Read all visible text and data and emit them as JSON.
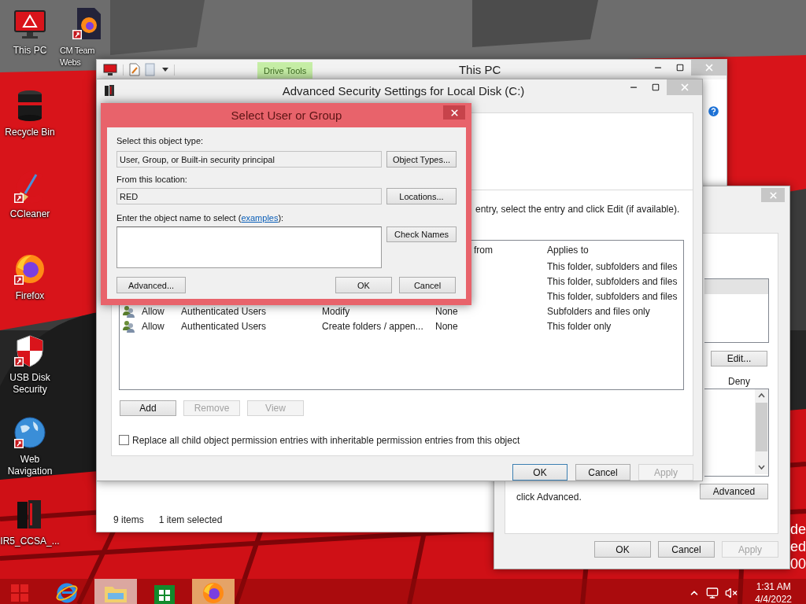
{
  "desktop": {
    "columns": [
      [
        {
          "kind": "this_pc",
          "label": "This PC",
          "shortcut": false
        },
        {
          "kind": "recycle_bin",
          "label": "Recycle Bin",
          "shortcut": false
        },
        {
          "kind": "ccleaner",
          "label": "CCleaner",
          "shortcut": true
        },
        {
          "kind": "firefox",
          "label": "Firefox",
          "shortcut": true
        },
        {
          "kind": "usb_security",
          "label": "USB Disk Security",
          "shortcut": true
        },
        {
          "kind": "web_navigation",
          "label": "Web Navigation",
          "shortcut": true
        },
        {
          "kind": "ir5",
          "label": "IR5_CCSA_...",
          "shortcut": false
        }
      ],
      [
        {
          "kind": "web_document",
          "label": "CM Team Webs",
          "shortcut": true
        }
      ]
    ],
    "corner_text": [
      "de",
      "ed",
      "00"
    ]
  },
  "explorer": {
    "title": "This PC",
    "ribbon_tab": "Drive Tools",
    "status": [
      "9 items",
      "1 item selected"
    ]
  },
  "properties": {
    "list_rows": [
      {
        "selected": true
      }
    ],
    "deny_header": "Deny",
    "edit_button": "Edit...",
    "note": "click Advanced.",
    "advanced_button": "Advanced",
    "footer_buttons": [
      {
        "label": "OK",
        "disabled": false,
        "default": false
      },
      {
        "label": "Cancel",
        "disabled": false,
        "default": false
      },
      {
        "label": "Apply",
        "disabled": true,
        "default": false
      }
    ]
  },
  "advanced": {
    "title": "Advanced Security Settings for Local Disk (C:)",
    "hint": "entry, select the entry and click Edit (if available).",
    "columns": [
      "from",
      "Applies to"
    ],
    "rows": [
      {
        "applies_to": "This folder, subfolders and files"
      },
      {
        "applies_to": "This folder, subfolders and files"
      },
      {
        "applies_to": "This folder, subfolders and files"
      },
      {
        "type": "Allow",
        "principal": "Authenticated Users",
        "access": "Modify",
        "inherited_from": "None",
        "applies_to": "Subfolders and files only"
      },
      {
        "type": "Allow",
        "principal": "Authenticated Users",
        "access": "Create folders / appen...",
        "inherited_from": "None",
        "applies_to": "This folder only"
      }
    ],
    "actions": [
      {
        "label": "Add",
        "disabled": false
      },
      {
        "label": "Remove",
        "disabled": true
      },
      {
        "label": "View",
        "disabled": true
      }
    ],
    "replace_checkbox": {
      "label": "Replace all child object permission entries with inheritable permission entries from this object",
      "checked": false
    },
    "footer_buttons": [
      {
        "label": "OK",
        "disabled": false,
        "default": true
      },
      {
        "label": "Cancel",
        "disabled": false,
        "default": false
      },
      {
        "label": "Apply",
        "disabled": true,
        "default": false
      }
    ]
  },
  "select_dialog": {
    "title": "Select User or Group",
    "object_type_label": "Select this object type:",
    "object_type": "User, Group, or Built-in security principal",
    "object_types_button": "Object Types...",
    "location_label": "From this location:",
    "location": "RED",
    "locations_button": "Locations...",
    "name_label_before": "Enter the object name to select (",
    "name_link": "examples",
    "name_label_after": "):",
    "check_names_button": "Check Names",
    "advanced_button": "Advanced...",
    "ok_button": "OK",
    "cancel_button": "Cancel"
  },
  "taskbar": {
    "apps": [
      {
        "kind": "ie",
        "running": false
      },
      {
        "kind": "explorer",
        "running": true
      },
      {
        "kind": "store",
        "running": false
      },
      {
        "kind": "firefox",
        "running": true
      }
    ],
    "clock": {
      "time": "1:31 AM",
      "date": "4/4/2022"
    }
  }
}
